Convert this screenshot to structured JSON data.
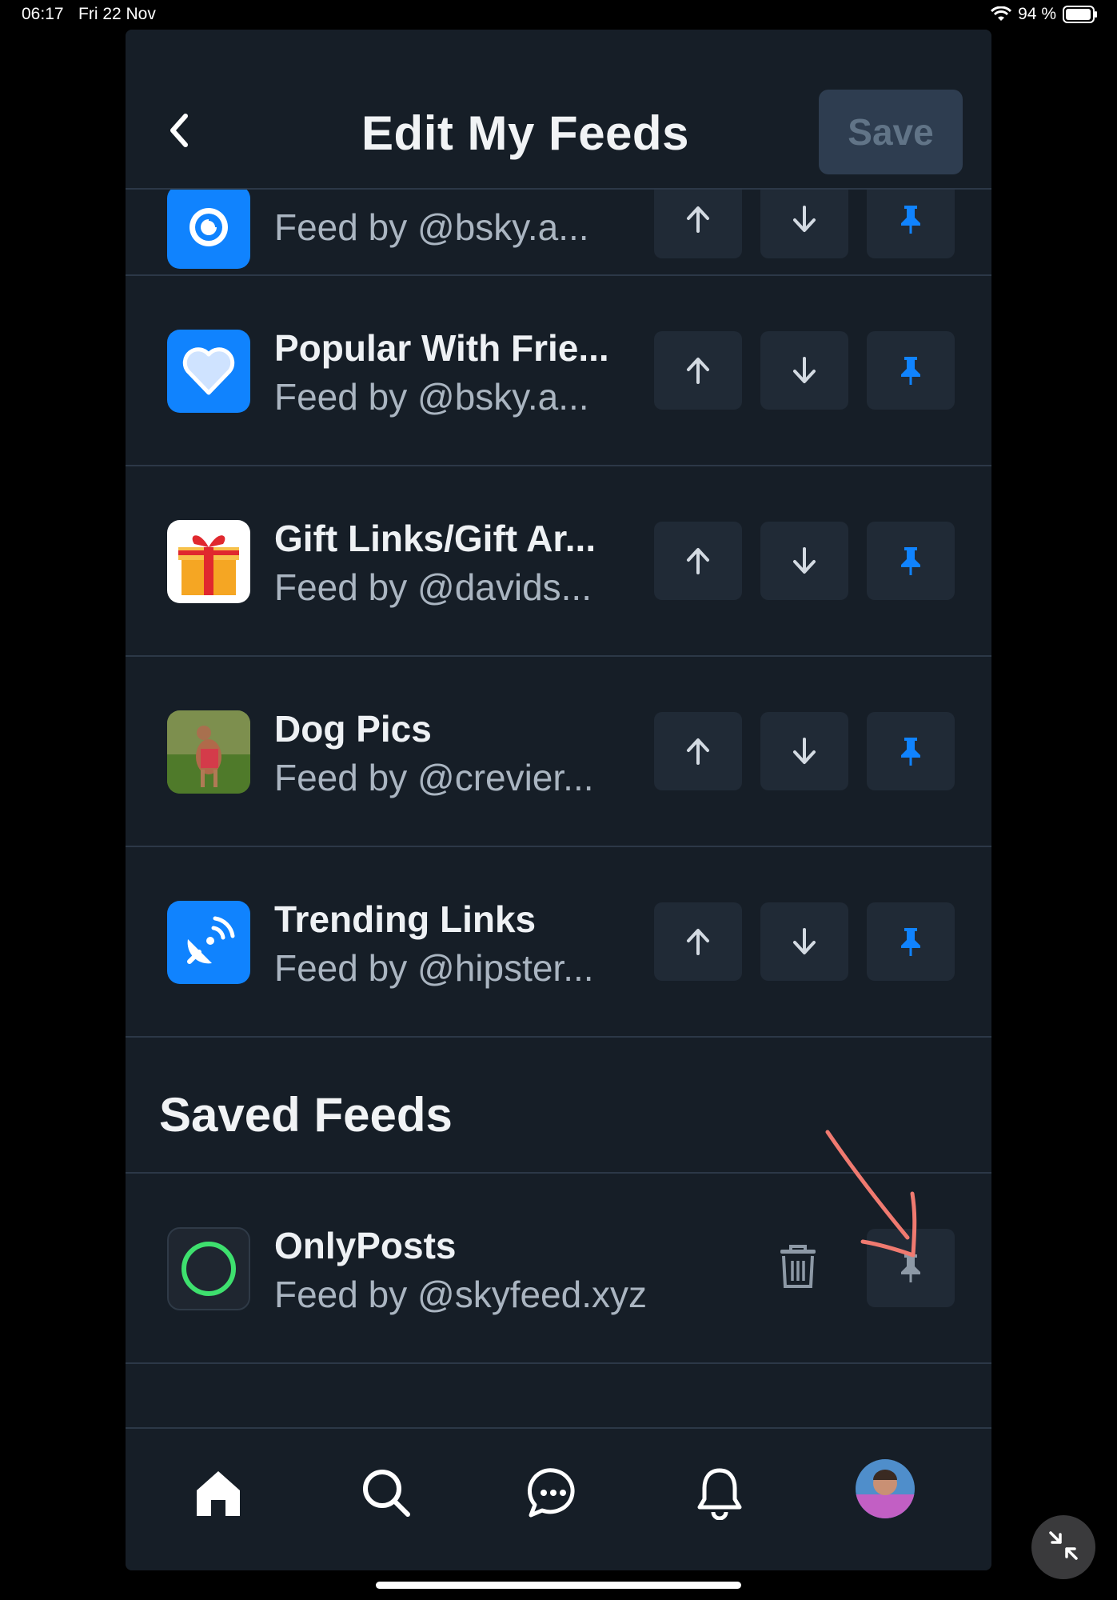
{
  "status_bar": {
    "time": "06:17",
    "date": "Fri 22 Nov",
    "battery": "94 %"
  },
  "header": {
    "title": "Edit My Feeds",
    "save_label": "Save"
  },
  "pinned_feeds": [
    {
      "name": "",
      "subtitle": "Feed by @bsky.a...",
      "icon": "discover-icon"
    },
    {
      "name": "Popular With Frie...",
      "subtitle": "Feed by @bsky.a...",
      "icon": "heart-icon"
    },
    {
      "name": "Gift Links/Gift Ar...",
      "subtitle": "Feed by @davids...",
      "icon": "gift-icon"
    },
    {
      "name": "Dog Pics",
      "subtitle": "Feed by @crevier...",
      "icon": "dog-photo"
    },
    {
      "name": "Trending Links",
      "subtitle": "Feed by @hipster...",
      "icon": "satellite-dish-icon"
    }
  ],
  "saved_section": {
    "title": "Saved Feeds"
  },
  "saved_feeds": [
    {
      "name": "OnlyPosts",
      "subtitle": "Feed by @skyfeed.xyz",
      "icon": "green-ring-icon"
    }
  ],
  "tab_bar": {
    "tabs": [
      "home-icon",
      "search-icon",
      "chat-icon",
      "bell-icon",
      "avatar"
    ]
  },
  "colors": {
    "background": "#161e27",
    "button": "#202a36",
    "accent": "#1083fe",
    "annotation": "#f07a70"
  }
}
